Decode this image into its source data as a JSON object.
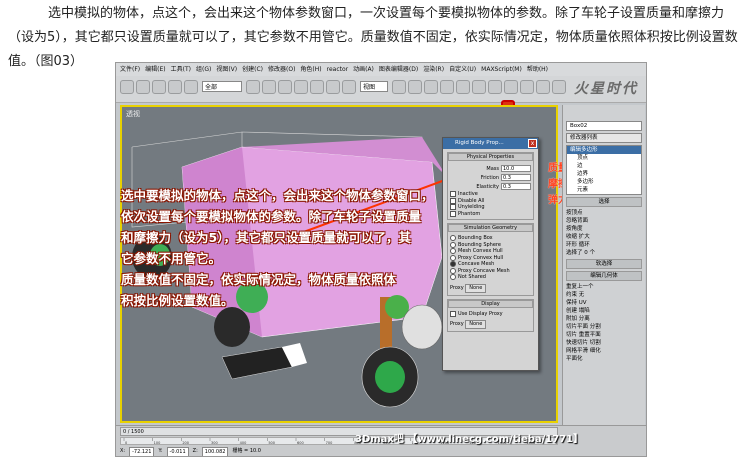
{
  "intro_text": "选中模拟的物体，点这个，会出来这个物体参数窗口，一次设置每个要模拟物体的参数。除了车轮子设置质量和摩擦力（设为5），其它都只设置质量就可以了，其它参数不用管它。质量数值不固定，依实际情况定，物体质量依照体积按比例设置数值。（图03）",
  "menu": [
    "文件(F)",
    "编辑(E)",
    "工具(T)",
    "组(G)",
    "视图(V)",
    "创建(C)",
    "修改器(O)",
    "角色(H)",
    "reactor",
    "动画(A)",
    "图表编辑器(D)",
    "渲染(R)",
    "自定义(U)",
    "MAXScript(M)",
    "帮助(H)"
  ],
  "toolbar": {
    "selection_filter": "全部",
    "view_combo": "视图",
    "logo_text": "火星时代"
  },
  "viewport": {
    "label": "透视"
  },
  "overlay_lines": [
    "选中要模拟的物体，点这个，会出来这个物体参数窗口，",
    "依次设置每个要模拟物体的参数。除了车轮子设置质量",
    "和摩擦力（设为5），其它都只设置质量就可以了，其",
    "它参数不用管它。",
    "质量数值不固定，依实际情况定，物体质量依照体",
    "积按比例设置数值。"
  ],
  "labels": {
    "mass": "质量",
    "friction": "摩擦力",
    "elasticity": "弹力"
  },
  "dialog": {
    "title": "Rigid Body Prop...",
    "close": "x",
    "physical": {
      "header": "Physical Properties",
      "mass_label": "Mass",
      "mass_value": "10.0",
      "friction_label": "Friction",
      "friction_value": "0.3",
      "elasticity_label": "Elasticity",
      "elasticity_value": "0.3",
      "options": [
        "Inactive",
        "Disable All",
        "Unyielding",
        "Phantom"
      ]
    },
    "geometry": {
      "header": "Simulation Geometry",
      "options": [
        "Bounding Box",
        "Bounding Sphere",
        "Mesh Convex Hull",
        "Proxy Convex Hull",
        "Concave Mesh",
        "Proxy Concave Mesh",
        "Not Shared"
      ],
      "selected_index": 4,
      "proxy_label": "Proxy",
      "proxy_button": "None"
    },
    "display": {
      "header": "Display",
      "option": "Use Display Proxy",
      "proxy_label": "Proxy",
      "proxy_button": "None"
    }
  },
  "right_panel": {
    "object_name": "Box02",
    "modifier_list": "修改器列表",
    "stack": [
      "编辑多边形",
      "顶点",
      "边",
      "边界",
      "多边形",
      "元素"
    ],
    "sections": [
      "选择",
      "软选择",
      "编辑几何体"
    ],
    "items": [
      "按顶点",
      "忽略背面",
      "按角度",
      "收缩",
      "扩大",
      "环形",
      "循环",
      "选择了 0 个",
      "重复上一个",
      "约束",
      "无",
      "保持 UV",
      "创建",
      "塌陷",
      "附加",
      "分离",
      "切片平面",
      "分割",
      "切片",
      "重置平面",
      "快速切片",
      "切割",
      "网格平滑",
      "细化",
      "平面化"
    ]
  },
  "bottom": {
    "frame": "0 / 1500",
    "ticks": [
      "0",
      "100",
      "200",
      "300",
      "400",
      "500",
      "600",
      "700",
      "800",
      "900",
      "1000",
      "1100",
      "1200",
      "1300",
      "1400",
      "1500"
    ],
    "x_label": "X:",
    "x_value": "-72.121",
    "y_label": "Y:",
    "y_value": "-0.011",
    "z_label": "Z:",
    "z_value": "100.082",
    "grid": "栅格 = 10.0"
  },
  "watermark": "3Dmax吧 【www.linecg.com/tieba/1771】"
}
